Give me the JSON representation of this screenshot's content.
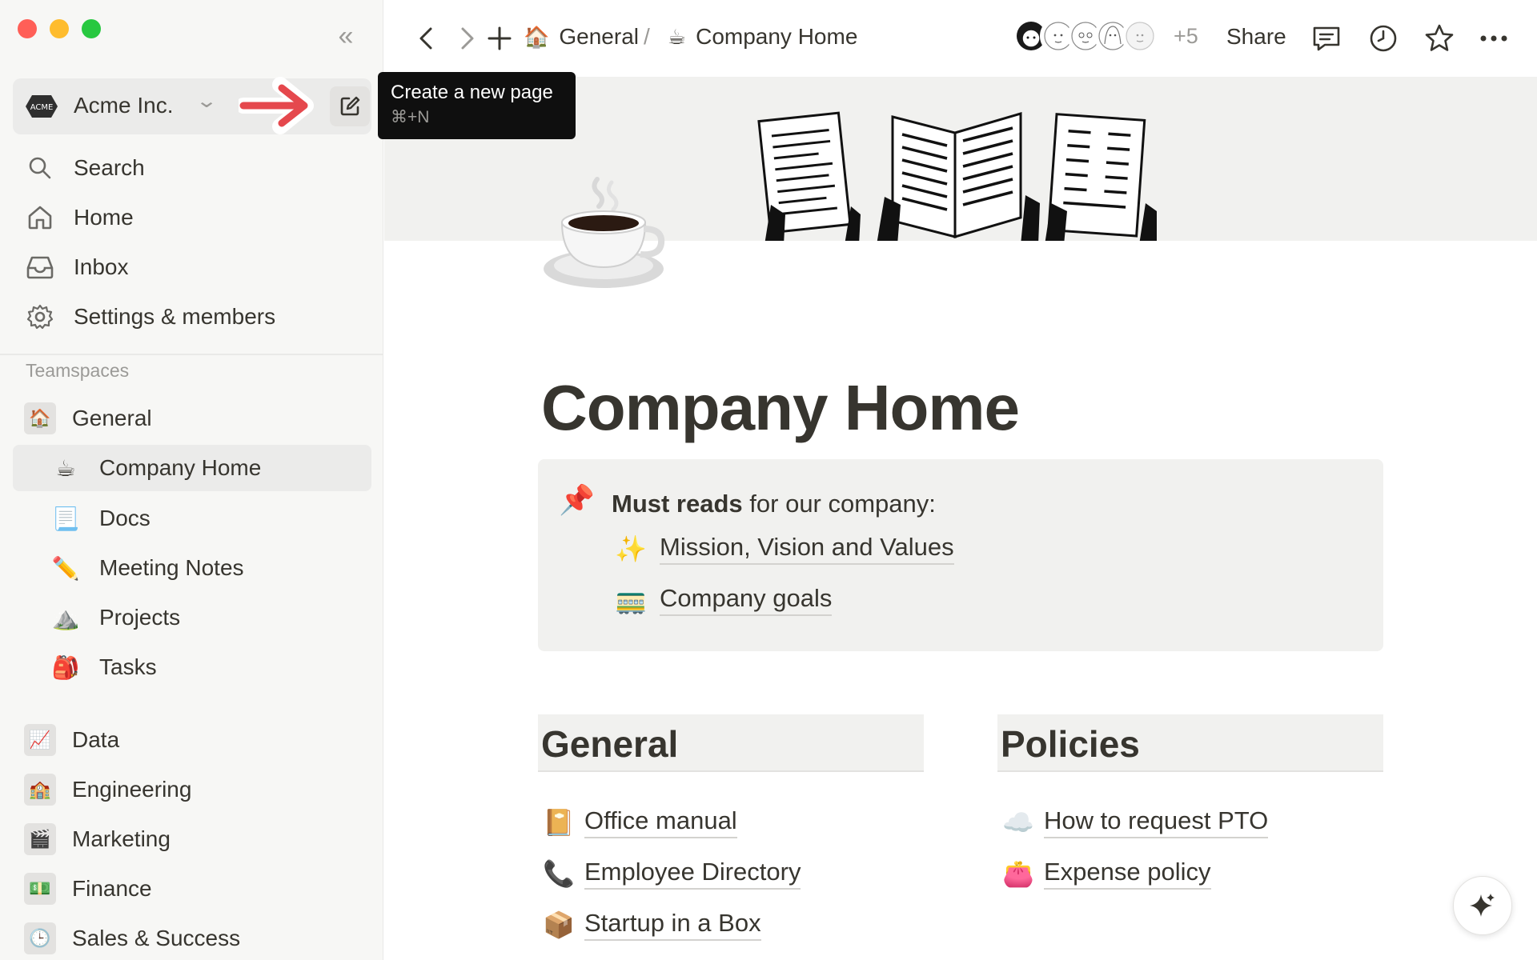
{
  "sidebar": {
    "workspace": {
      "name": "Acme Inc.",
      "logo_text": "ACME"
    },
    "nav": [
      {
        "label": "Search",
        "icon": "search-icon"
      },
      {
        "label": "Home",
        "icon": "home-icon"
      },
      {
        "label": "Inbox",
        "icon": "inbox-icon"
      },
      {
        "label": "Settings & members",
        "icon": "gear-icon"
      }
    ],
    "section_label": "Teamspaces",
    "teamspace_general": {
      "label": "General",
      "icon": "🏠"
    },
    "pages": [
      {
        "label": "Company Home",
        "icon": "☕"
      },
      {
        "label": "Docs",
        "icon": "📃"
      },
      {
        "label": "Meeting Notes",
        "icon": "✏️"
      },
      {
        "label": "Projects",
        "icon": "⛰️"
      },
      {
        "label": "Tasks",
        "icon": "🎒"
      }
    ],
    "teamspaces": [
      {
        "label": "Data",
        "icon": "📈"
      },
      {
        "label": "Engineering",
        "icon": "🏫"
      },
      {
        "label": "Marketing",
        "icon": "🎬"
      },
      {
        "label": "Finance",
        "icon": "💵"
      },
      {
        "label": "Sales & Success",
        "icon": "🕒"
      }
    ]
  },
  "tooltip": {
    "title": "Create a new page",
    "shortcut": "⌘+N"
  },
  "topbar": {
    "breadcrumb": {
      "parent": "General",
      "parent_icon": "🏠",
      "separator": "/",
      "current": "Company Home",
      "current_icon": "☕"
    },
    "avatars_more": "+5",
    "share_label": "Share"
  },
  "page": {
    "title": "Company Home",
    "callout": {
      "icon": "📌",
      "lead_bold": "Must reads",
      "lead_rest": " for our company:",
      "links": [
        {
          "label": "Mission, Vision and Values",
          "icon": "✨"
        },
        {
          "label": "Company goals",
          "icon": "🚃"
        }
      ]
    },
    "columns": [
      {
        "heading": "General",
        "links": [
          {
            "label": "Office manual",
            "icon": "📔"
          },
          {
            "label": "Employee Directory",
            "icon": "📞"
          },
          {
            "label": "Startup in a Box",
            "icon": "📦"
          }
        ]
      },
      {
        "heading": "Policies",
        "links": [
          {
            "label": "How to request PTO",
            "icon": "☁️"
          },
          {
            "label": "Expense policy",
            "icon": "👛"
          }
        ]
      }
    ]
  },
  "colors": {
    "sidebar_bg": "#f7f7f5",
    "text": "#37352f",
    "muted": "#9b9a97",
    "arrow": "#e5484d"
  }
}
